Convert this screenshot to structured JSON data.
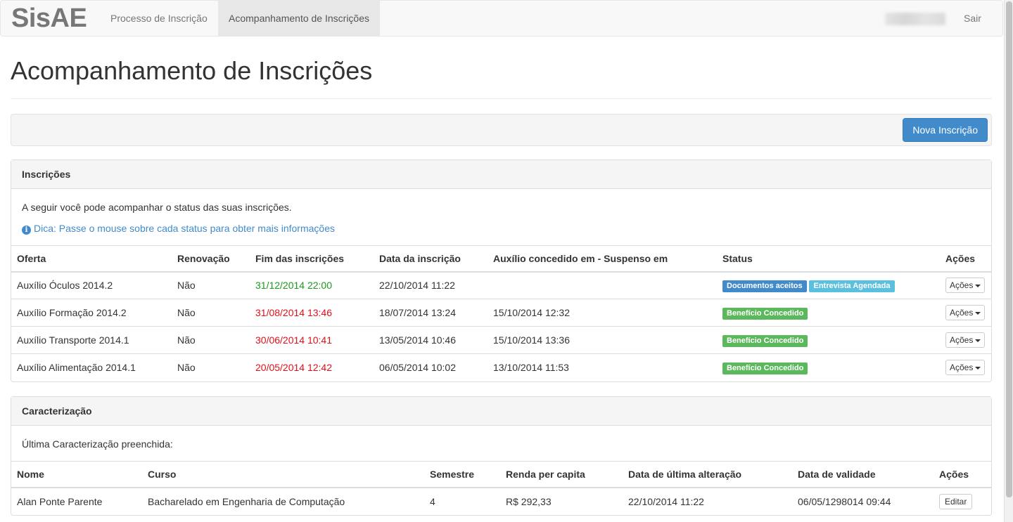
{
  "navbar": {
    "brand": "SisAE",
    "items": [
      {
        "label": "Processo de Inscrição",
        "active": false
      },
      {
        "label": "Acompanhamento de Inscrições",
        "active": true
      }
    ],
    "logout": "Sair"
  },
  "page": {
    "title": "Acompanhamento de Inscrições",
    "new_button": "Nova Inscrição"
  },
  "inscricoes": {
    "heading": "Inscrições",
    "intro": "A seguir você pode acompanhar o status das suas inscrições.",
    "tip": "Dica: Passe o mouse sobre cada status para obter mais informações",
    "columns": [
      "Oferta",
      "Renovação",
      "Fim das inscrições",
      "Data da inscrição",
      "Auxílio concedido em - Suspenso em",
      "Status",
      "Ações"
    ],
    "rows": [
      {
        "oferta": "Auxílio Óculos 2014.2",
        "renovacao": "Não",
        "fim": "31/12/2014 22:00",
        "fim_color": "#1a9b1a",
        "data": "22/10/2014 11:22",
        "concedido": "",
        "status": [
          {
            "text": "Documentos aceitos",
            "color": "#428bca"
          },
          {
            "text": "Entrevista Agendada",
            "color": "#5bc0de"
          }
        ],
        "acao": "Ações"
      },
      {
        "oferta": "Auxílio Formação 2014.2",
        "renovacao": "Não",
        "fim": "31/08/2014 13:46",
        "fim_color": "#e0101a",
        "data": "18/07/2014 13:24",
        "concedido": "15/10/2014 12:32",
        "status": [
          {
            "text": "Benefício Concedido",
            "color": "#5cb85c"
          }
        ],
        "acao": "Ações"
      },
      {
        "oferta": "Auxílio Transporte 2014.1",
        "renovacao": "Não",
        "fim": "30/06/2014 10:41",
        "fim_color": "#e0101a",
        "data": "13/05/2014 10:46",
        "concedido": "15/10/2014 13:36",
        "status": [
          {
            "text": "Benefício Concedido",
            "color": "#5cb85c"
          }
        ],
        "acao": "Ações"
      },
      {
        "oferta": "Auxílio Alimentação 2014.1",
        "renovacao": "Não",
        "fim": "20/05/2014 12:42",
        "fim_color": "#e0101a",
        "data": "06/05/2014 10:02",
        "concedido": "13/10/2014 11:53",
        "status": [
          {
            "text": "Benefício Concedido",
            "color": "#5cb85c"
          }
        ],
        "acao": "Ações"
      }
    ]
  },
  "caracterizacao": {
    "heading": "Caracterização",
    "intro": "Última Caracterização preenchida:",
    "columns": [
      "Nome",
      "Curso",
      "Semestre",
      "Renda per capita",
      "Data de última alteração",
      "Data de validade",
      "Ações"
    ],
    "rows": [
      {
        "nome": "Alan Ponte Parente",
        "curso": "Bacharelado em Engenharia de Computação",
        "semestre": "4",
        "renda": "R$ 292,33",
        "alteracao": "22/10/2014 11:22",
        "validade": "06/05/1298014 09:44",
        "acao": "Editar"
      }
    ]
  }
}
